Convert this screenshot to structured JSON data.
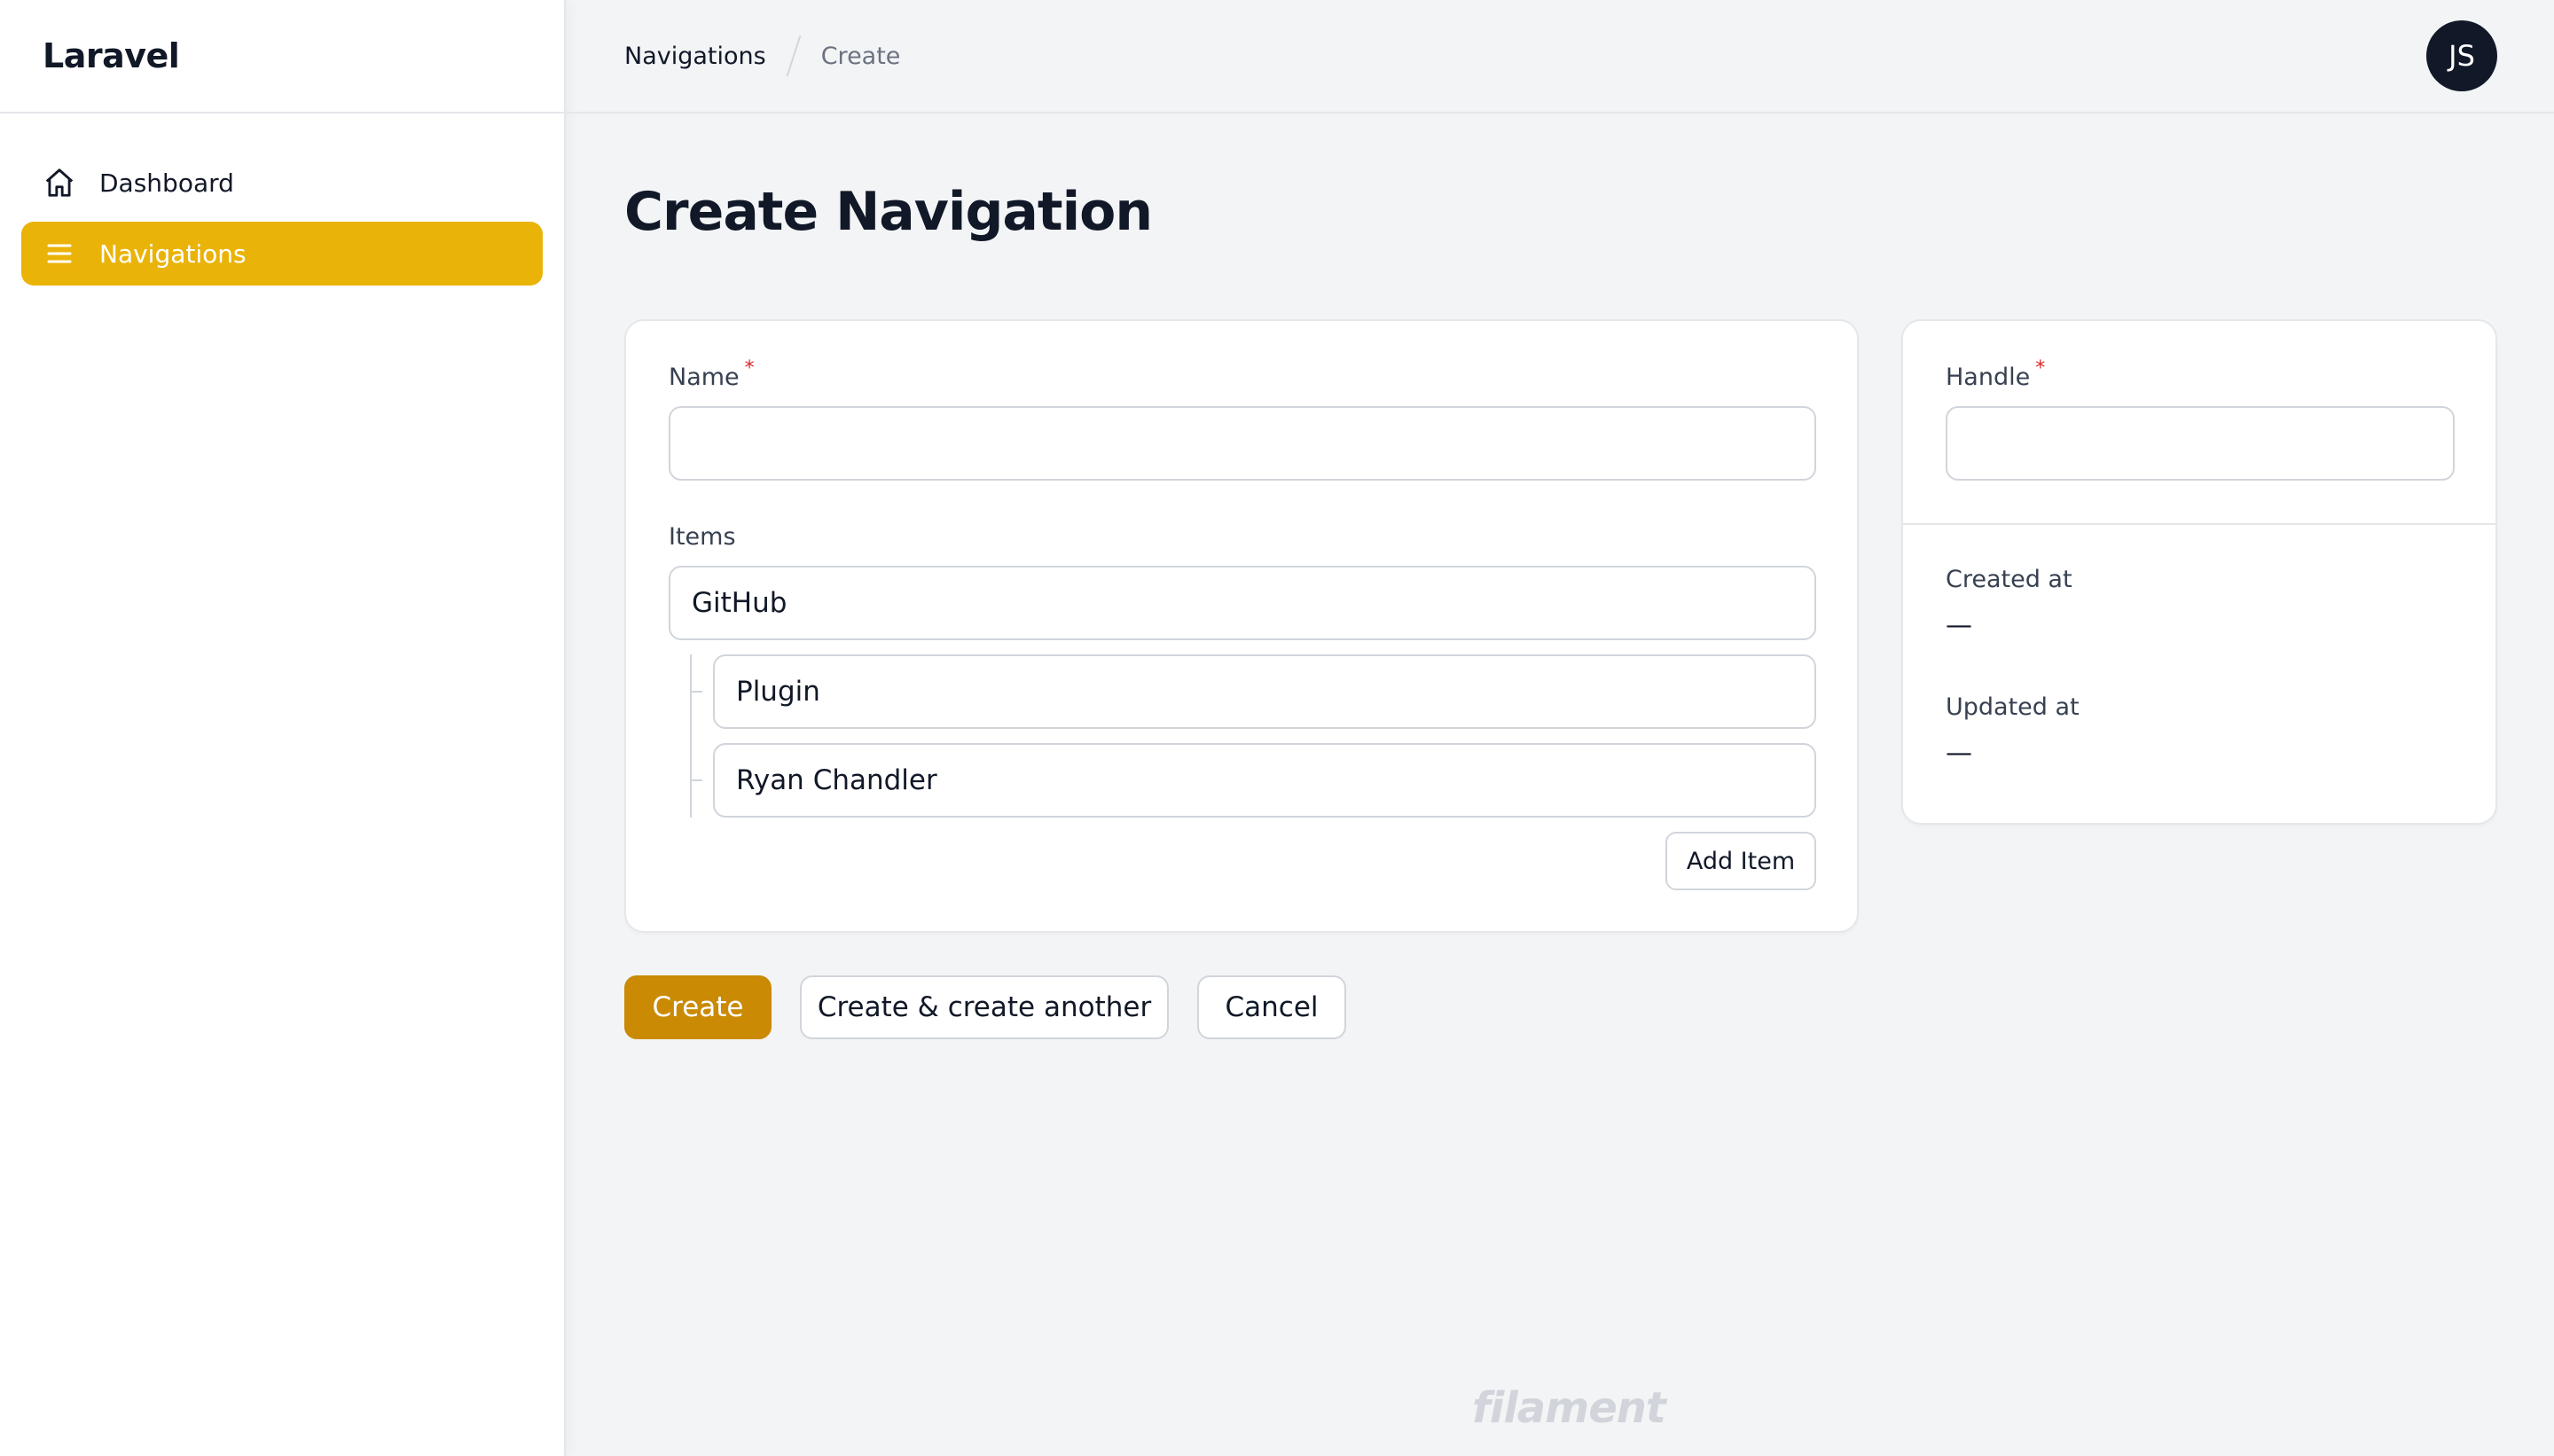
{
  "brand": {
    "name": "Laravel"
  },
  "sidebar": {
    "items": [
      {
        "label": "Dashboard",
        "icon": "home-icon",
        "active": false
      },
      {
        "label": "Navigations",
        "icon": "menu-icon",
        "active": true
      }
    ]
  },
  "breadcrumbs": {
    "items": [
      "Navigations",
      "Create"
    ]
  },
  "user": {
    "initials": "JS"
  },
  "page": {
    "title": "Create Navigation"
  },
  "form": {
    "name": {
      "label": "Name",
      "required_mark": "*",
      "value": ""
    },
    "items": {
      "label": "Items",
      "entries": [
        {
          "label": "GitHub",
          "children": [
            {
              "label": "Plugin"
            },
            {
              "label": "Ryan Chandler"
            }
          ]
        }
      ],
      "add_label": "Add Item"
    },
    "handle": {
      "label": "Handle",
      "required_mark": "*",
      "value": ""
    },
    "created_at": {
      "label": "Created at",
      "value": "—"
    },
    "updated_at": {
      "label": "Updated at",
      "value": "—"
    }
  },
  "actions": {
    "create": "Create",
    "create_another": "Create & create another",
    "cancel": "Cancel"
  },
  "footer": {
    "logo": "filament"
  },
  "colors": {
    "accent": "#eab308",
    "primary_button": "#ca8a04",
    "background": "#f3f4f6",
    "required": "#dc2626"
  }
}
